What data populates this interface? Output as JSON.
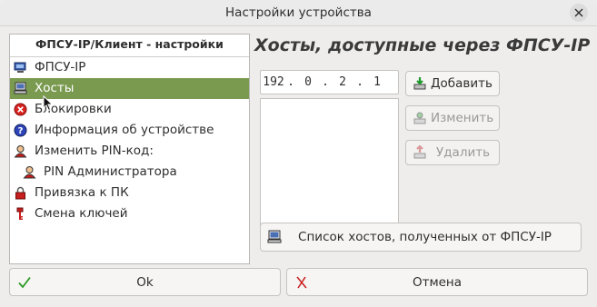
{
  "window": {
    "title": "Настройки устройства"
  },
  "left": {
    "header": "ФПСУ-IP/Клиент - настройки",
    "items": [
      {
        "label": "ФПСУ-IP",
        "icon": "monitor-icon"
      },
      {
        "label": "Хосты",
        "icon": "computer-icon",
        "selected": true
      },
      {
        "label": "Блокировки",
        "icon": "block-icon"
      },
      {
        "label": "Информация об устройстве",
        "icon": "info-icon"
      },
      {
        "label": "Изменить PIN-код:",
        "icon": "user-icon"
      },
      {
        "label": "PIN Администратора",
        "icon": "none"
      },
      {
        "label": "Привязка к ПК",
        "icon": "lock-icon"
      },
      {
        "label": "Смена ключей",
        "icon": "key-icon"
      }
    ]
  },
  "right": {
    "title": "Хосты, доступные через ФПСУ-IP",
    "ip": [
      "192",
      "0",
      "2",
      "1"
    ],
    "buttons": {
      "add": "Добавить",
      "edit": "Изменить",
      "delete": "Удалить"
    },
    "host_list_button": "Список хостов, полученных от ФПСУ-IP"
  },
  "footer": {
    "ok": "Ok",
    "cancel": "Отмена"
  }
}
